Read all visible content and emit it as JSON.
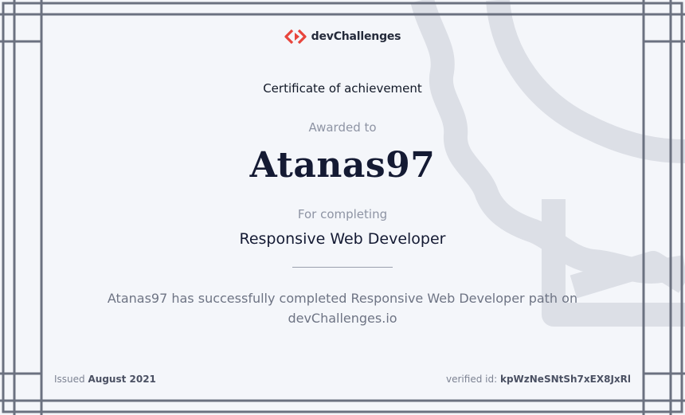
{
  "logo": {
    "text": "devChallenges"
  },
  "certificate": {
    "title": "Certificate of achievement",
    "awarded_label": "Awarded to",
    "recipient": "Atanas97",
    "for_label": "For completing",
    "course": "Responsive Web Developer",
    "description_line1": "Atanas97 has successfully completed Responsive Web Developer path on",
    "description_line2": "devChallenges.io"
  },
  "footer": {
    "issued_label": "Issued",
    "issued_date": "August 2021",
    "verified_label": "verified id:",
    "verified_id": "kpWzNeSNtSh7xEX8JxRl"
  },
  "colors": {
    "brand_red": "#e8453c",
    "frame": "#6b7180",
    "seal": "#dcdfe6"
  },
  "icons": {
    "logo_icon": "devchallenges-logo-icon",
    "seal": "seal-ribbon-decoration"
  }
}
